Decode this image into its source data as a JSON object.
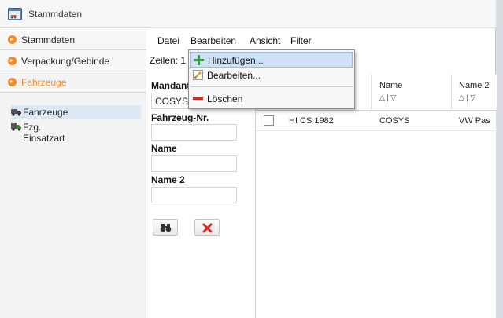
{
  "window": {
    "title": "Stammdaten"
  },
  "sidebar": {
    "sections": [
      {
        "label": "Stammdaten",
        "active": false
      },
      {
        "label": "Verpackung/Gebinde",
        "active": false
      },
      {
        "label": "Fahrzeuge",
        "active": true
      }
    ],
    "tree": [
      {
        "label": "Fahrzeuge",
        "selected": true,
        "icon": "truck-icon"
      },
      {
        "label": "Fzg. Einsatzart",
        "selected": false,
        "icon": "truck-type-icon"
      }
    ]
  },
  "menubar": {
    "items": [
      "Datei",
      "Bearbeiten",
      "Ansicht",
      "Filter"
    ]
  },
  "rows_label": "Zeilen: 1",
  "filter": {
    "mandant_label": "Mandant",
    "mandant_value": "COSYS",
    "fahrzeug_nr_label": "Fahrzeug-Nr.",
    "fahrzeug_nr_value": "",
    "name_label": "Name",
    "name_value": "",
    "name2_label": "Name 2",
    "name2_value": "",
    "search_icon": "binoculars-icon",
    "clear_icon": "red-x-icon"
  },
  "grid": {
    "columns": [
      "Name",
      "Name 2"
    ],
    "sort_glyph": "△ | ▽",
    "rows": [
      {
        "number": "HI CS 1982",
        "name": "COSYS",
        "name2": "VW Pas"
      }
    ]
  },
  "dropdown": {
    "items": [
      {
        "label": "Hinzufügen...",
        "icon": "plus-icon",
        "hover": true
      },
      {
        "label": "Bearbeiten...",
        "icon": "edit-icon",
        "hover": false
      },
      {
        "label": "Löschen",
        "icon": "delete-icon",
        "hover": false
      }
    ]
  },
  "colors": {
    "accent": "#f28c28",
    "selection": "#dde8f5",
    "menu_hover": "#cfe2f5"
  }
}
